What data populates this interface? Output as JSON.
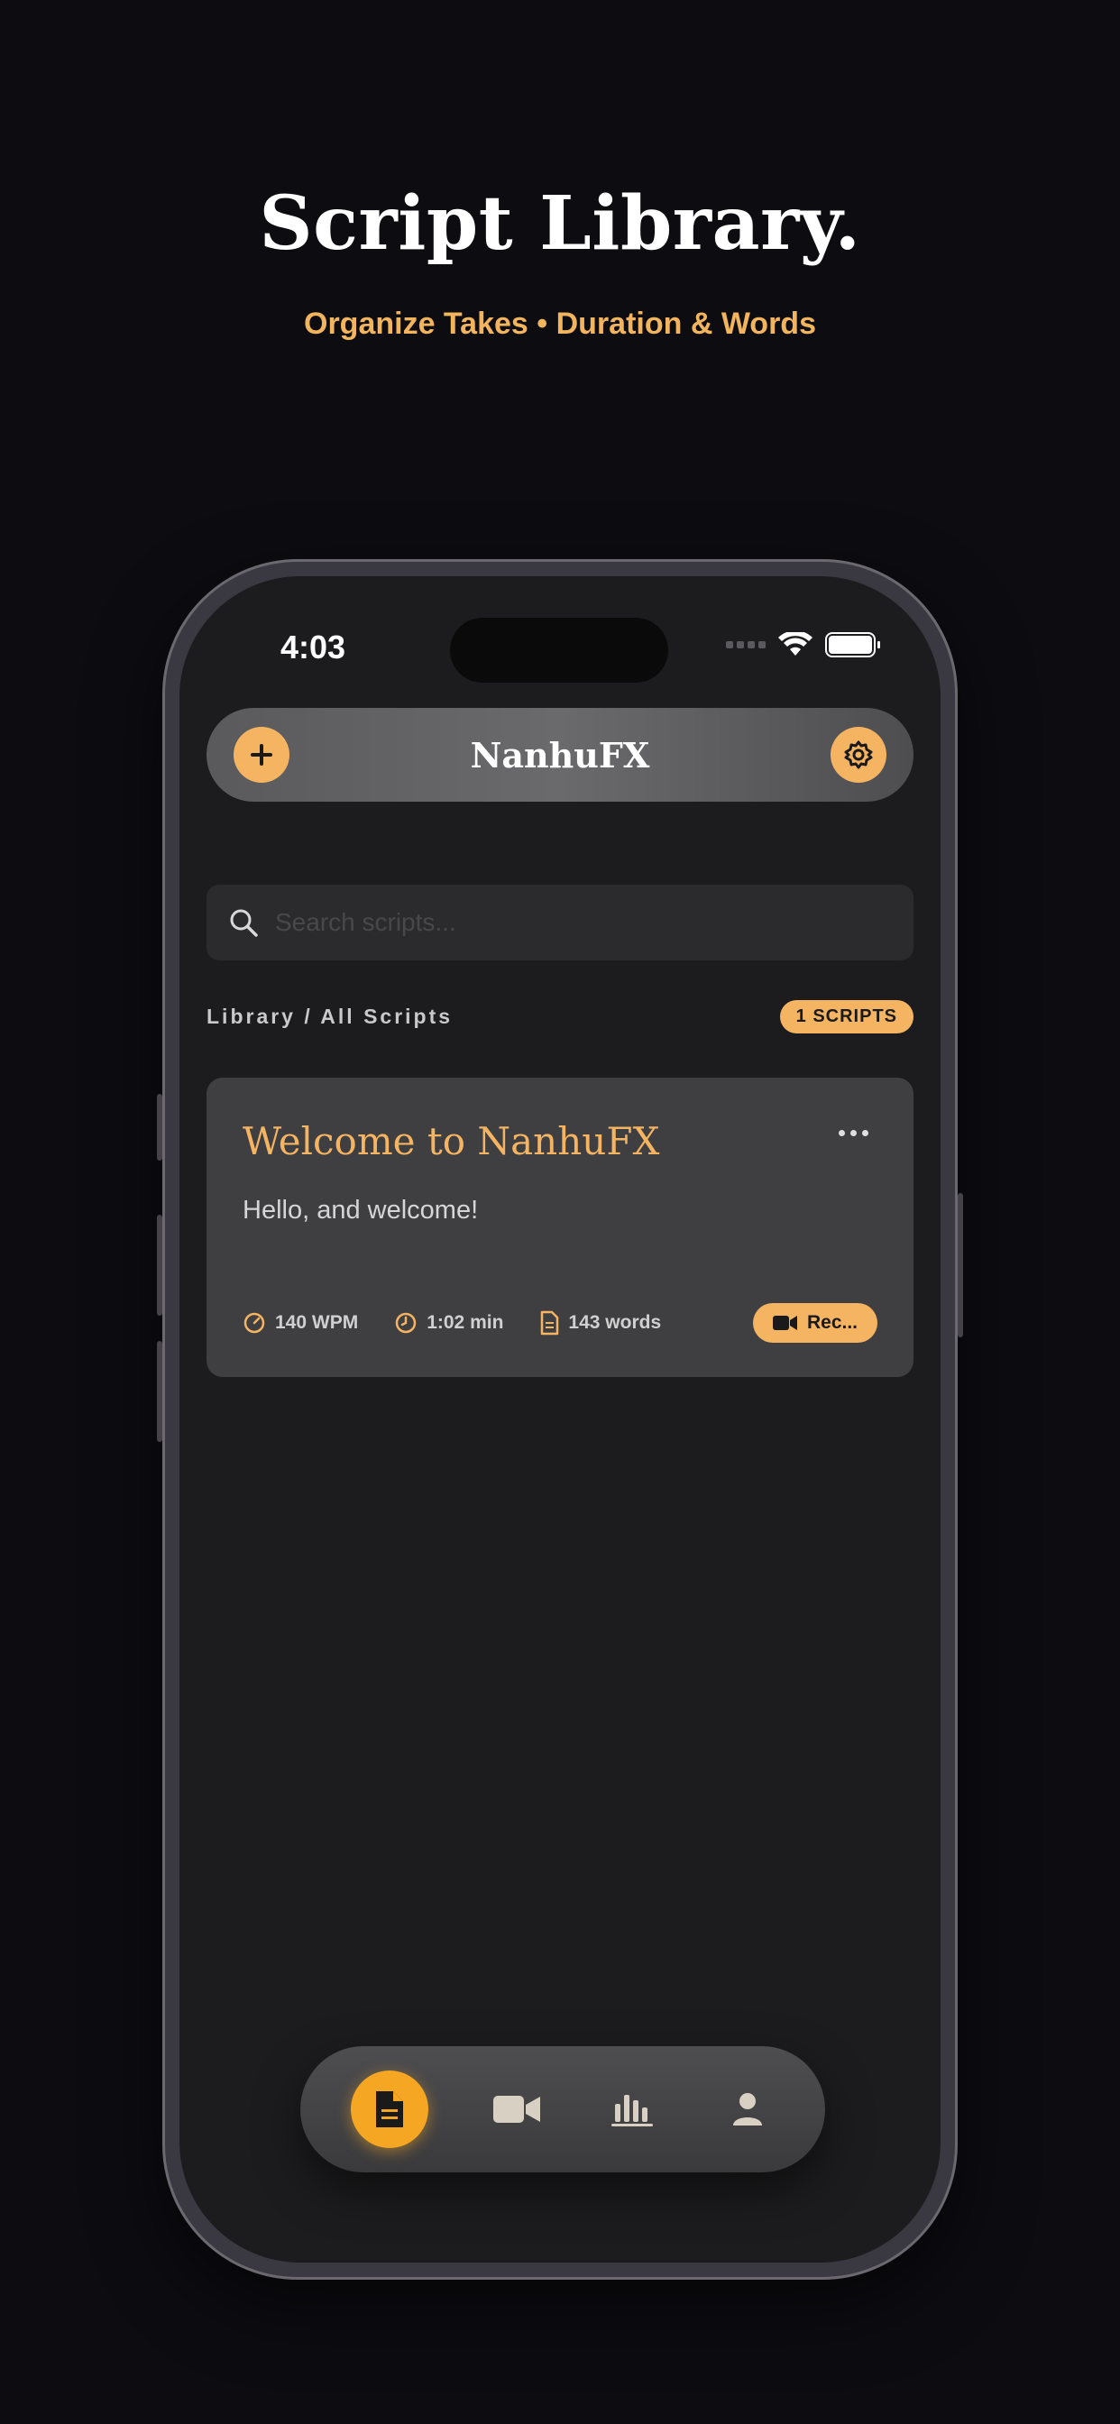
{
  "promo": {
    "headline": "Script Library.",
    "subhead": "Organize Takes • Duration & Words"
  },
  "status_bar": {
    "time": "4:03"
  },
  "header": {
    "title": "NanhuFX",
    "add_icon": "plus-icon",
    "settings_icon": "gear-icon"
  },
  "search": {
    "placeholder": "Search scripts...",
    "value": ""
  },
  "library": {
    "breadcrumb": "Library / All Scripts",
    "count_badge": "1 SCRIPTS"
  },
  "scripts": [
    {
      "title": "Welcome to NanhuFX",
      "preview": "Hello, and welcome!",
      "wpm": "140 WPM",
      "duration": "1:02 min",
      "words": "143 words",
      "record_label": "Rec..."
    }
  ],
  "tabbar": {
    "tabs": [
      "document-icon",
      "video-camera-icon",
      "bar-chart-icon",
      "person-icon"
    ],
    "active": 0
  },
  "colors": {
    "accent": "#f5b462",
    "accent_strong": "#f5a623",
    "background": "#0d0c11",
    "screen": "#1c1c1e",
    "card": "#3f3f41"
  }
}
